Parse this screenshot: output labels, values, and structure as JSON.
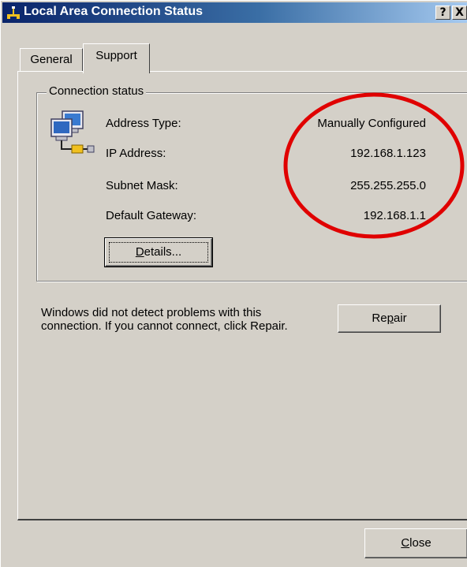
{
  "window": {
    "title": "Local Area Connection Status",
    "help_button": "?",
    "close_button": "X"
  },
  "tabs": [
    {
      "label": "General",
      "active": false
    },
    {
      "label": "Support",
      "active": true
    }
  ],
  "connection_status": {
    "group_title": "Connection status",
    "rows": [
      {
        "label": "Address Type:",
        "value": "Manually Configured"
      },
      {
        "label": "IP Address:",
        "value": "192.168.1.123"
      },
      {
        "label": "Subnet Mask:",
        "value": "255.255.255.0"
      },
      {
        "label": "Default Gateway:",
        "value": "192.168.1.1"
      }
    ],
    "details_button": {
      "before": "",
      "mnemonic": "D",
      "after": "etails..."
    }
  },
  "repair": {
    "message": "Windows did not detect problems with this connection. If you cannot connect, click Repair.",
    "button": {
      "before": "Re",
      "mnemonic": "p",
      "after": "air"
    }
  },
  "footer": {
    "close_button": {
      "before": "",
      "mnemonic": "C",
      "after": "lose"
    }
  },
  "annotation": {
    "circle_color": "#e00000"
  },
  "colors": {
    "dialog_face": "#d4d0c8",
    "titlebar_start": "#0a246a",
    "titlebar_end": "#a6caf0"
  },
  "icons": {
    "title": "network-connection-icon",
    "status": "network-computers-icon"
  }
}
